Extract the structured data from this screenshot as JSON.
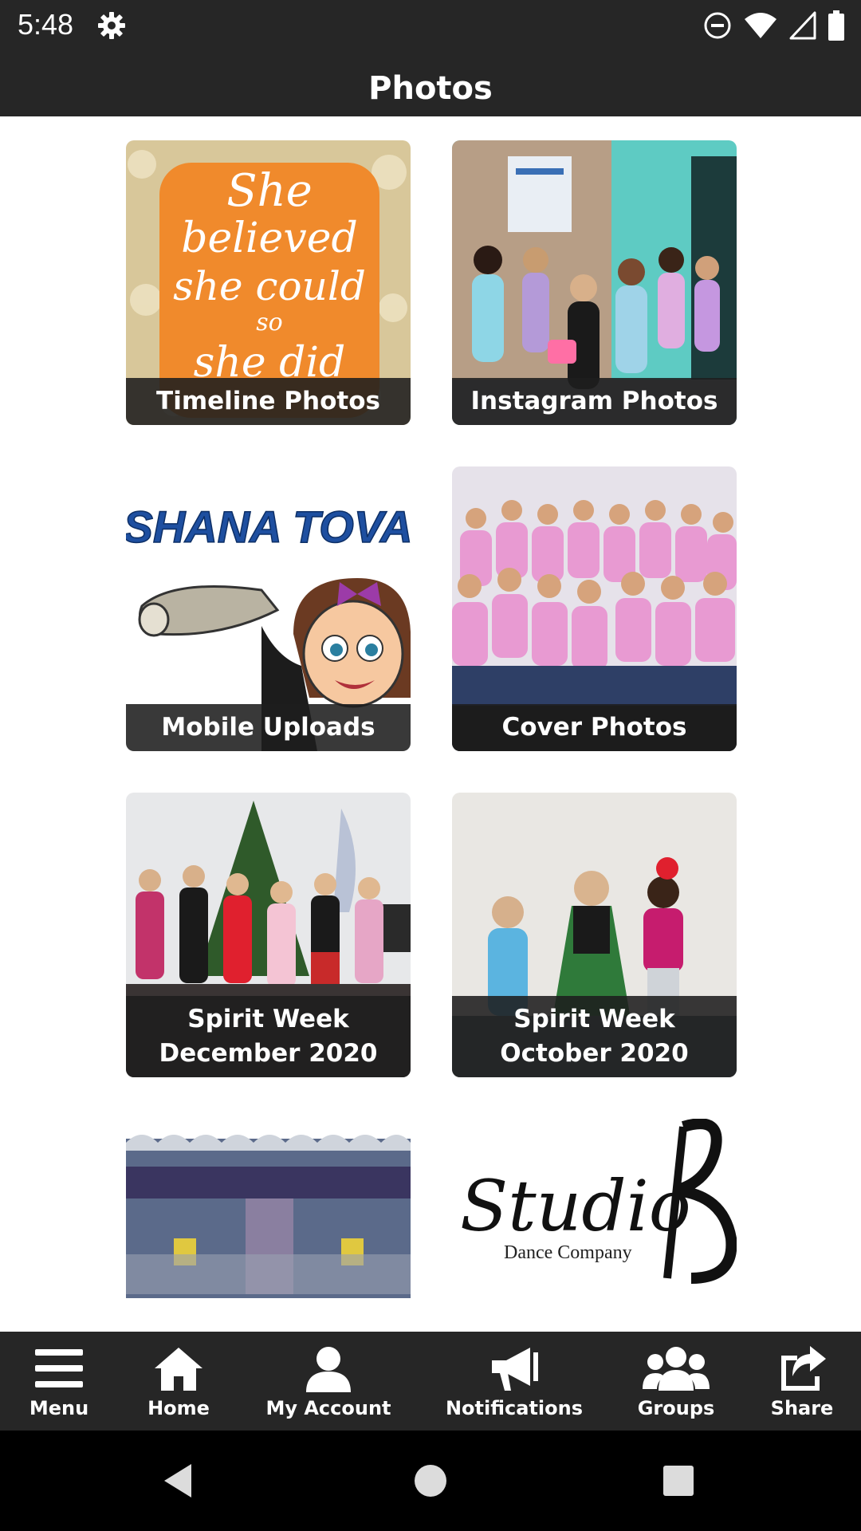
{
  "status_bar": {
    "time": "5:48"
  },
  "app_bar": {
    "title": "Photos"
  },
  "albums": [
    {
      "label": "Timeline Photos",
      "image_text": [
        "She",
        "believed",
        "she could",
        "so",
        "she did"
      ]
    },
    {
      "label": "Instagram Photos"
    },
    {
      "label": "Mobile Uploads",
      "image_text": "SHANA TOVA"
    },
    {
      "label": "Cover Photos"
    },
    {
      "label": "Spirit Week December 2020"
    },
    {
      "label": "Spirit Week October 2020"
    },
    {
      "label": ""
    },
    {
      "label": "",
      "image_text": [
        "Studio",
        "Dance Company"
      ]
    }
  ],
  "bottom_nav": [
    {
      "label": "Menu",
      "icon": "menu-icon"
    },
    {
      "label": "Home",
      "icon": "home-icon"
    },
    {
      "label": "My Account",
      "icon": "account-icon"
    },
    {
      "label": "Notifications",
      "icon": "megaphone-icon"
    },
    {
      "label": "Groups",
      "icon": "groups-icon"
    },
    {
      "label": "Share",
      "icon": "share-icon"
    }
  ],
  "colors": {
    "bar": "#262626",
    "label_bg": "#1e1e1e",
    "orange": "#f08a2c"
  }
}
